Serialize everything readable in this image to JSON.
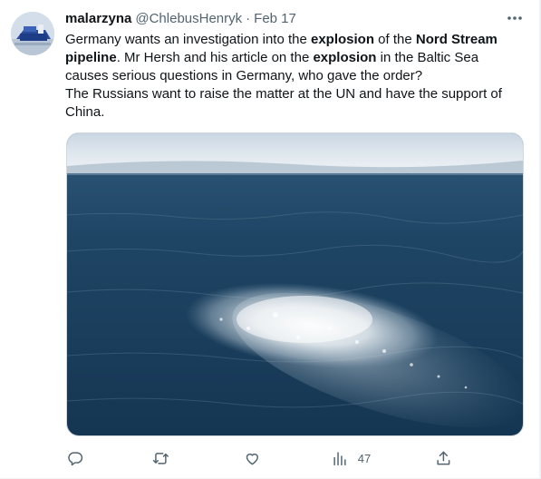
{
  "tweet": {
    "display_name": "malarzyna",
    "handle": "@ChlebusHenryk",
    "separator": "·",
    "date": "Feb 17",
    "text": {
      "p1": "Germany wants an investigation into the ",
      "b1": "explosion",
      "p2": " of the ",
      "b2": "Nord Stream pipeline",
      "p3": ". Mr Hersh and his article on the ",
      "b3": "explosion",
      "p4": " in the Baltic Sea causes serious questions in Germany, who gave the order?",
      "p5": "The Russians want to raise the matter at the UN and have the support of China."
    },
    "more_icon": "more-icon",
    "media_alt": "aerial view of gas bubbling on the sea surface"
  },
  "actions": {
    "reply": {
      "icon": "reply-icon"
    },
    "retweet": {
      "icon": "retweet-icon"
    },
    "like": {
      "icon": "like-icon"
    },
    "views": {
      "icon": "views-icon",
      "count": "47"
    },
    "share": {
      "icon": "share-icon"
    }
  },
  "colors": {
    "text": "#0f1419",
    "secondary": "#536471",
    "border": "#cfd9de"
  }
}
